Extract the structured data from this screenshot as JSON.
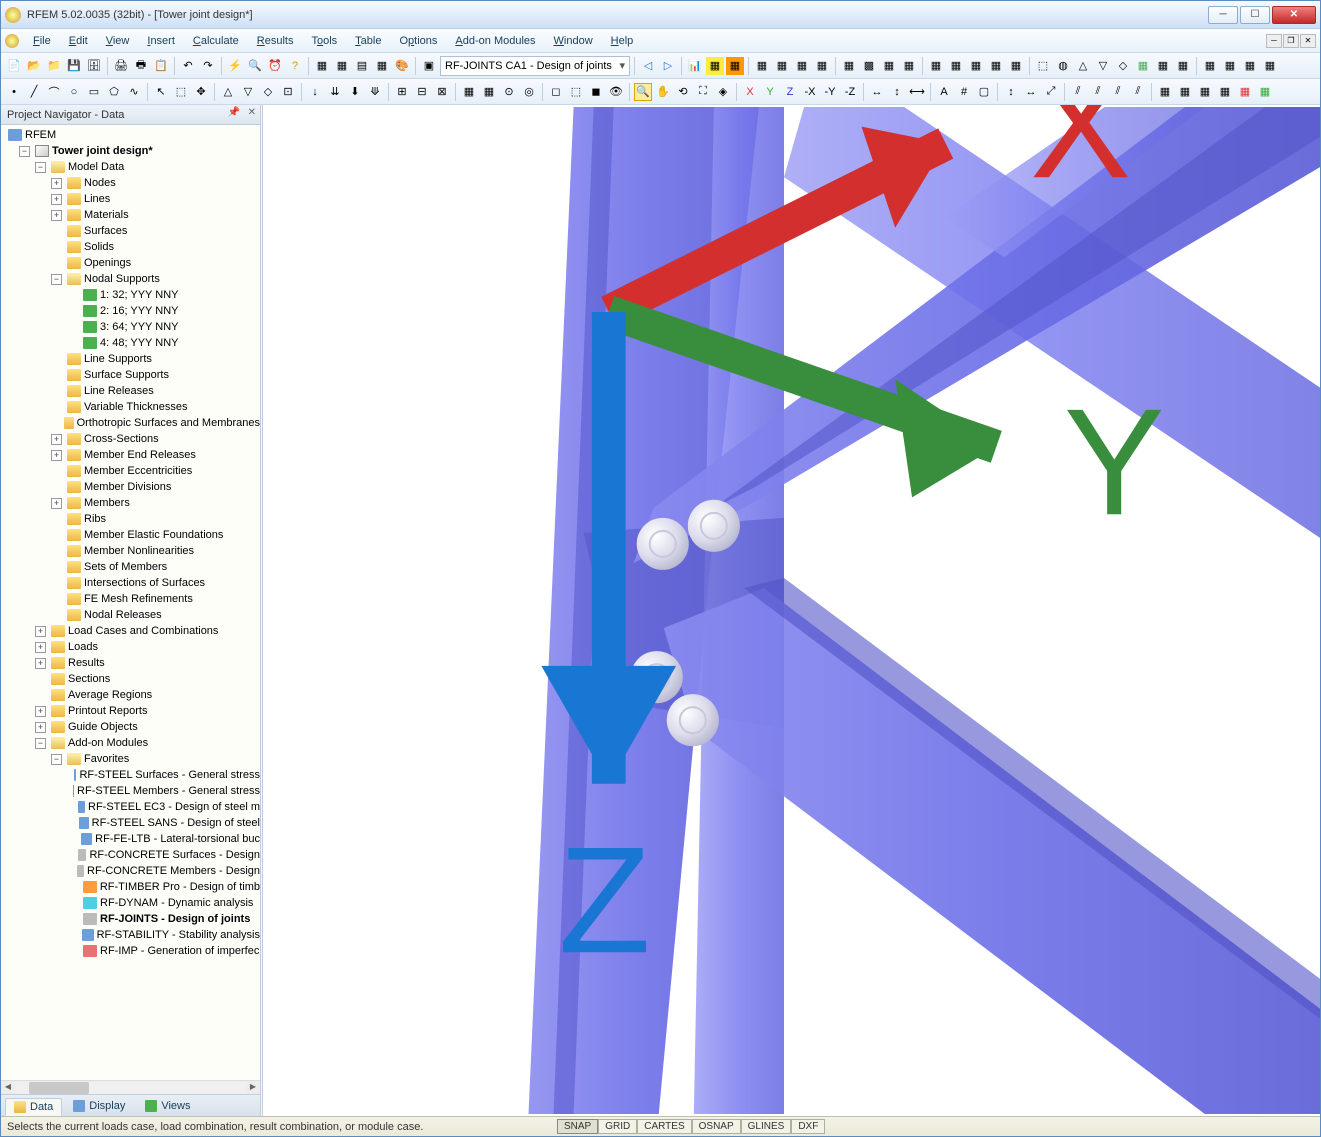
{
  "window": {
    "title": "RFEM 5.02.0035 (32bit) - [Tower joint design*]"
  },
  "menu": {
    "items": [
      "File",
      "Edit",
      "View",
      "Insert",
      "Calculate",
      "Results",
      "Tools",
      "Table",
      "Options",
      "Add-on Modules",
      "Window",
      "Help"
    ]
  },
  "toolbar": {
    "combo_value": "RF-JOINTS CA1 - Design of joints"
  },
  "navigator": {
    "title": "Project Navigator - Data",
    "root": "RFEM",
    "project": "Tower joint design*",
    "model_data": "Model Data",
    "nodes": "Nodes",
    "lines": "Lines",
    "materials": "Materials",
    "surfaces": "Surfaces",
    "solids": "Solids",
    "openings": "Openings",
    "nodal_supports": "Nodal Supports",
    "ns1": "1: 32; YYY NNY",
    "ns2": "2: 16; YYY NNY",
    "ns3": "3: 64; YYY NNY",
    "ns4": "4: 48; YYY NNY",
    "line_supports": "Line Supports",
    "surface_supports": "Surface Supports",
    "line_releases": "Line Releases",
    "variable_thicknesses": "Variable Thicknesses",
    "orthotropic": "Orthotropic Surfaces and Membranes",
    "cross_sections": "Cross-Sections",
    "member_end_releases": "Member End Releases",
    "member_ecc": "Member Eccentricities",
    "member_divisions": "Member Divisions",
    "members": "Members",
    "ribs": "Ribs",
    "member_elastic": "Member Elastic Foundations",
    "member_nonlin": "Member Nonlinearities",
    "sets_of_members": "Sets of Members",
    "intersections": "Intersections of Surfaces",
    "fe_mesh": "FE Mesh Refinements",
    "nodal_releases": "Nodal Releases",
    "load_cases": "Load Cases and Combinations",
    "loads": "Loads",
    "results": "Results",
    "sections": "Sections",
    "avg_regions": "Average Regions",
    "printout": "Printout Reports",
    "guide_objects": "Guide Objects",
    "addon_modules": "Add-on Modules",
    "favorites": "Favorites",
    "rf_steel_surfaces": "RF-STEEL Surfaces - General stress",
    "rf_steel_members": "RF-STEEL Members - General stress",
    "rf_steel_ec3": "RF-STEEL EC3 - Design of steel m",
    "rf_steel_sans": "RF-STEEL SANS - Design of steel",
    "rf_fe_ltb": "RF-FE-LTB - Lateral-torsional buc",
    "rf_concrete_surf": "RF-CONCRETE Surfaces - Design",
    "rf_concrete_mem": "RF-CONCRETE Members - Design",
    "rf_timber": "RF-TIMBER Pro - Design of timb",
    "rf_dynam": "RF-DYNAM - Dynamic analysis",
    "rf_joints": "RF-JOINTS - Design of joints",
    "rf_stability": "RF-STABILITY - Stability analysis",
    "rf_imp": "RF-IMP - Generation of imperfec"
  },
  "nav_tabs": {
    "data": "Data",
    "display": "Display",
    "views": "Views"
  },
  "status": {
    "hint": "Selects the current loads case, load combination, result combination, or module case.",
    "buttons": [
      "SNAP",
      "GRID",
      "CARTES",
      "OSNAP",
      "GLINES",
      "DXF"
    ]
  },
  "axis": {
    "x": "X",
    "y": "Y",
    "z": "Z"
  }
}
